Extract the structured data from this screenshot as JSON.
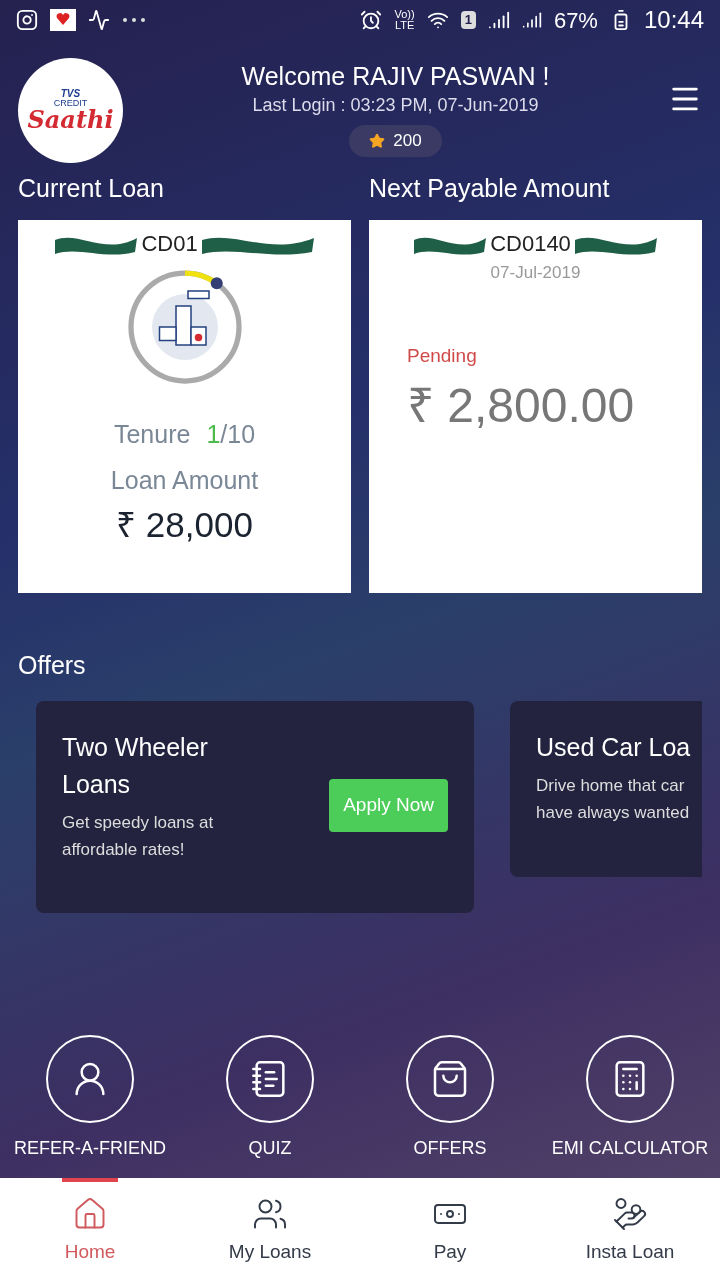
{
  "status_bar": {
    "network": "Vo))",
    "network_type": "LTE",
    "sim": "1",
    "battery": "67%",
    "time": "10:44"
  },
  "header": {
    "logo": {
      "brand": "TVS",
      "sub": "CREDIT",
      "name": "Saathi"
    },
    "welcome": "Welcome RAJIV PASWAN !",
    "last_login": "Last Login : 03:23 PM, 07-Jun-2019",
    "points": "200"
  },
  "current_loan": {
    "title": "Current Loan",
    "loan_number": "CD01",
    "level": 0.1,
    "tenure_label": "Tenure",
    "tenure_paid": "1",
    "tenure_total": "/10",
    "amount_label": "Loan Amount",
    "amount": "₹ 28,000"
  },
  "next_payable": {
    "title": "Next Payable Amount",
    "loan_number": "CD0140",
    "due_date": "07-Jul-2019",
    "status": "Pending",
    "amount": "₹ 2,800.00"
  },
  "offers": {
    "title": "Offers",
    "items": [
      {
        "title_lines": [
          "Two Wheeler",
          "Loans"
        ],
        "description_lines": [
          "Get speedy loans at",
          "affordable rates!"
        ],
        "button": "Apply Now"
      },
      {
        "title_lines": [
          "Used Car Loa"
        ],
        "description_lines": [
          "Drive home that car",
          "have always wanted"
        ]
      }
    ]
  },
  "quick_actions": [
    {
      "kind": "refer",
      "label": "REFER-A-FRIEND"
    },
    {
      "kind": "quiz",
      "label": "QUIZ"
    },
    {
      "kind": "offers",
      "label": "OFFERS"
    },
    {
      "kind": "calculator",
      "label": "EMI CALCULATOR"
    }
  ],
  "bottom_nav": [
    {
      "kind": "home",
      "label": "Home",
      "selected": true
    },
    {
      "kind": "loans",
      "label": "My Loans",
      "selected": false
    },
    {
      "kind": "pay",
      "label": "Pay",
      "selected": false
    },
    {
      "kind": "insta",
      "label": "Insta Loan",
      "selected": false
    }
  ]
}
